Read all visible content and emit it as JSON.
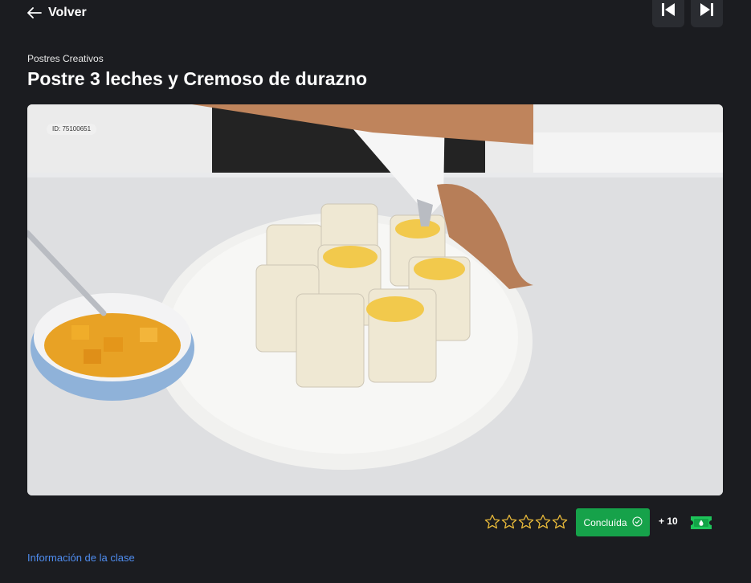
{
  "header": {
    "back_label": "Volver",
    "prev_button": "skip-previous-icon",
    "next_button": "skip-next-icon"
  },
  "course": {
    "category": "Postres Creativos",
    "title": "Postre 3 leches y Cremoso de durazno"
  },
  "video": {
    "id_label": "ID: 75100651"
  },
  "footer": {
    "rating": {
      "max": 5,
      "value": 0,
      "star_color": "#e8b93a"
    },
    "status_label": "Concluída",
    "status_icon": "check-circle-icon",
    "points_label": "+ 10",
    "points_icon": "ticket-icon",
    "info_link": "Información de la clase"
  },
  "colors": {
    "background": "#1b1c20",
    "accent_green": "#16a24a",
    "link_blue": "#4f8df0"
  }
}
